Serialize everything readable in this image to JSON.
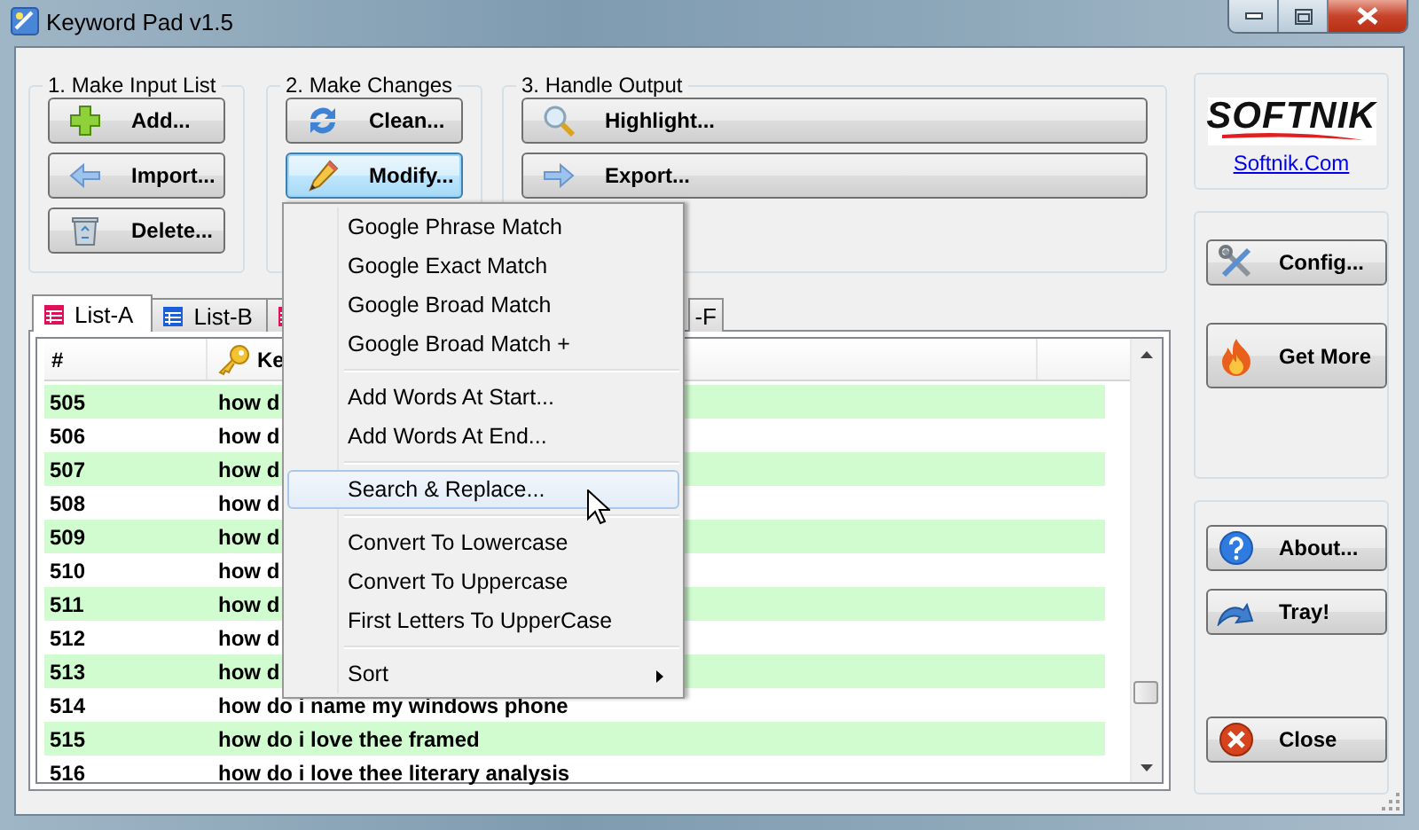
{
  "window": {
    "title": "Keyword Pad v1.5"
  },
  "groups": [
    {
      "title": "1. Make Input List",
      "buttons": [
        {
          "label": "Add...",
          "focused": false
        },
        {
          "label": "Import...",
          "focused": false
        },
        {
          "label": "Delete...",
          "focused": false
        }
      ]
    },
    {
      "title": "2. Make Changes",
      "buttons": [
        {
          "label": "Clean...",
          "focused": false
        },
        {
          "label": "Modify...",
          "focused": true
        }
      ]
    },
    {
      "title": "3. Handle Output",
      "buttons": [
        {
          "label": "Highlight...",
          "focused": false
        },
        {
          "label": "Export...",
          "focused": false
        }
      ]
    }
  ],
  "brand": {
    "logo": "SOFTNIK",
    "link": "Softnik.Com"
  },
  "side_panels": [
    {
      "buttons": [
        {
          "label": "Config..."
        },
        {
          "label": "Get More"
        }
      ]
    },
    {
      "buttons": [
        {
          "label": "About..."
        },
        {
          "label": "Tray!"
        },
        {
          "label": "Close"
        }
      ]
    }
  ],
  "tabs": [
    {
      "label": "List-A",
      "selected": true,
      "color": "#e0105a"
    },
    {
      "label": "List-B",
      "selected": false,
      "color": "#1a5fd6"
    },
    {
      "selected": false,
      "color": "#e0105a"
    },
    {
      "label": "-F",
      "selected": false
    }
  ],
  "list": {
    "columns": [
      "#",
      "Ke"
    ],
    "rows": [
      {
        "number": "505",
        "keyword": "how d",
        "highlighted": true
      },
      {
        "number": "506",
        "keyword": "how d",
        "highlighted": false
      },
      {
        "number": "507",
        "keyword": "how d",
        "highlighted": true
      },
      {
        "number": "508",
        "keyword": "how d",
        "highlighted": false
      },
      {
        "number": "509",
        "keyword": "how d",
        "highlighted": true
      },
      {
        "number": "510",
        "keyword": "how d",
        "highlighted": false
      },
      {
        "number": "511",
        "keyword": "how d",
        "highlighted": true
      },
      {
        "number": "512",
        "keyword": "how d",
        "highlighted": false
      },
      {
        "number": "513",
        "keyword": "how d",
        "highlighted": true
      },
      {
        "number": "514",
        "keyword": "how do i name my windows phone",
        "highlighted": false
      },
      {
        "number": "515",
        "keyword": "how do i love thee framed",
        "highlighted": true
      },
      {
        "number": "516",
        "keyword": "how do i love thee literary analysis",
        "highlighted": false
      }
    ]
  },
  "menu": {
    "items": [
      {
        "kind": "item",
        "label": "Google Phrase Match",
        "selected": false
      },
      {
        "kind": "item",
        "label": "Google Exact Match",
        "selected": false
      },
      {
        "kind": "item",
        "label": "Google Broad Match",
        "selected": false
      },
      {
        "kind": "item",
        "label": "Google Broad Match +",
        "selected": false
      },
      {
        "kind": "separator"
      },
      {
        "kind": "item",
        "label": "Add Words At Start...",
        "selected": false
      },
      {
        "kind": "item",
        "label": "Add Words At End...",
        "selected": false
      },
      {
        "kind": "separator"
      },
      {
        "kind": "item",
        "label": "Search & Replace...",
        "selected": true
      },
      {
        "kind": "separator"
      },
      {
        "kind": "item",
        "label": "Convert To Lowercase",
        "selected": false
      },
      {
        "kind": "item",
        "label": "Convert To Uppercase",
        "selected": false
      },
      {
        "kind": "item",
        "label": "First Letters To UpperCase",
        "selected": false
      },
      {
        "kind": "separator"
      },
      {
        "kind": "submenu",
        "label": "Sort",
        "selected": false
      }
    ]
  }
}
